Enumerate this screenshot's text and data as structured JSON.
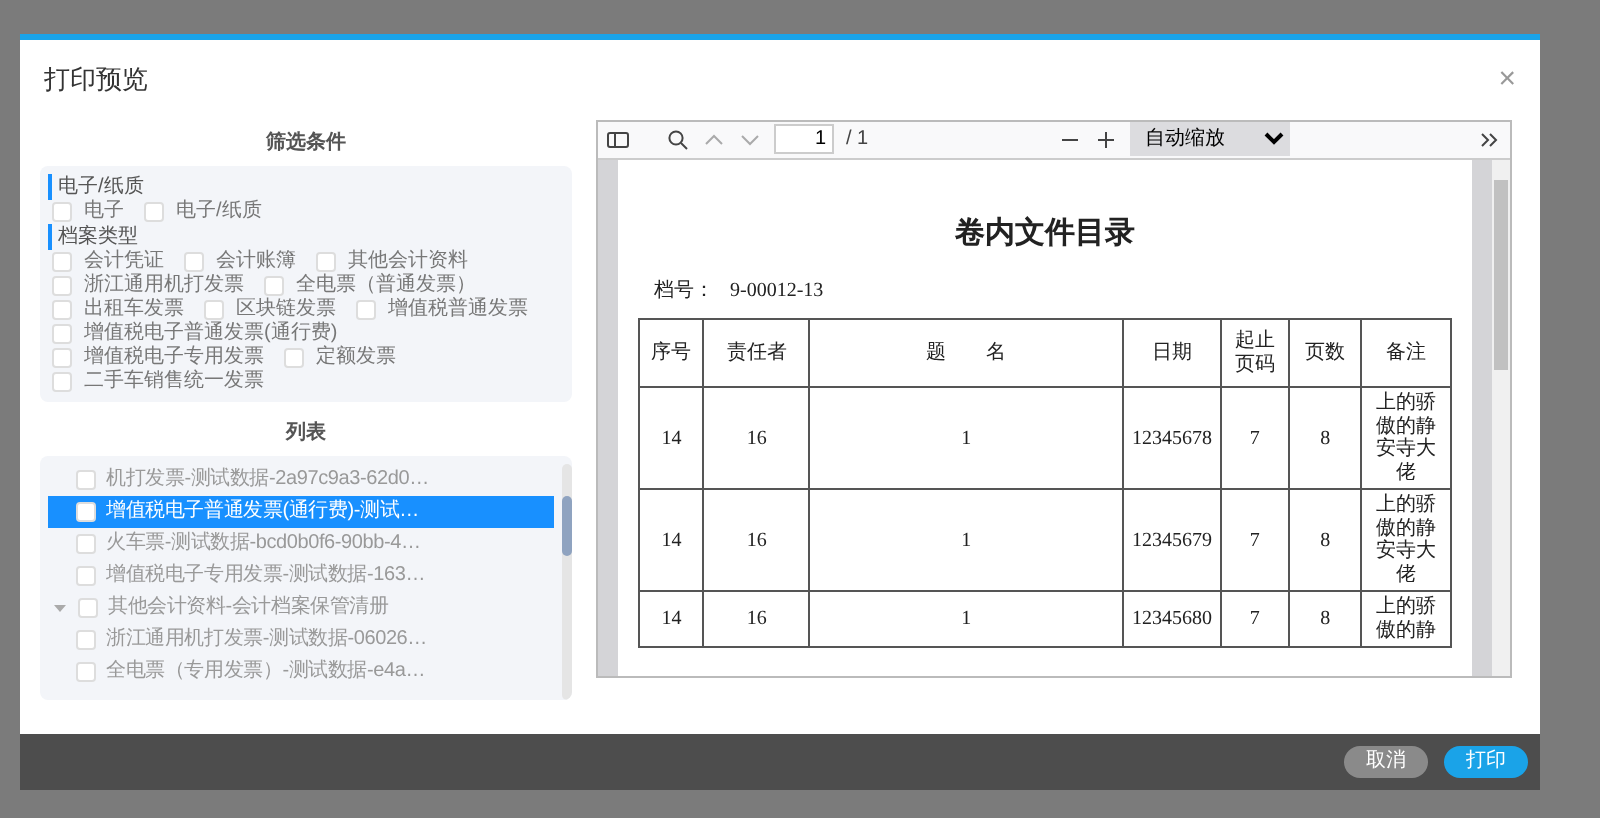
{
  "dialog": {
    "title": "打印预览",
    "close": "×"
  },
  "filter": {
    "title": "筛选条件",
    "groups": [
      {
        "label": "电子/纸质",
        "options": [
          {
            "label": "电子",
            "checked": false
          },
          {
            "label": "电子/纸质",
            "checked": false
          }
        ]
      },
      {
        "label": "档案类型",
        "options": [
          {
            "label": "会计凭证",
            "checked": false
          },
          {
            "label": "会计账簿",
            "checked": false
          },
          {
            "label": "其他会计资料",
            "checked": false
          },
          {
            "label": "浙江通用机打发票",
            "checked": false
          },
          {
            "label": "全电票（普通发票）",
            "checked": false
          },
          {
            "label": "出租车发票",
            "checked": false
          },
          {
            "label": "区块链发票",
            "checked": false
          },
          {
            "label": "增值税普通发票",
            "checked": false
          },
          {
            "label": "增值税电子普通发票(通行费)",
            "checked": false
          },
          {
            "label": "增值税电子专用发票",
            "checked": false
          },
          {
            "label": "定额发票",
            "checked": false
          },
          {
            "label": "二手车销售统一发票",
            "checked": false
          }
        ]
      }
    ]
  },
  "list": {
    "title": "列表",
    "items": [
      {
        "children": [
          {
            "label": "机打发票-测试数据-2a97c9a3-62d0…",
            "checked": false,
            "selected": false
          },
          {
            "label": "增值税电子普通发票(通行费)-测试…",
            "checked": false,
            "selected": true
          },
          {
            "label": "火车票-测试数据-bcd0b0f6-90bb-4…",
            "checked": false,
            "selected": false
          },
          {
            "label": "增值税电子专用发票-测试数据-163…",
            "checked": false,
            "selected": false
          }
        ]
      },
      {
        "label": "其他会计资料-会计档案保管清册",
        "checked": false,
        "selected": false,
        "expanded": true,
        "children": [
          {
            "label": "浙江通用机打发票-测试数据-06026…",
            "checked": false,
            "selected": false
          },
          {
            "label": "全电票（专用发票）-测试数据-e4a…",
            "checked": false,
            "selected": false
          }
        ]
      }
    ]
  },
  "viewer": {
    "page_number": "1",
    "page_count": "/ 1",
    "zoom": "自动缩放",
    "document": {
      "title": "卷内文件目录",
      "file_no_label": "档号：",
      "file_no": "9-00012-13",
      "columns": [
        "序号",
        "责任者",
        "题　　名",
        "日期",
        "起止页码",
        "页数",
        "备注"
      ],
      "rows": [
        [
          "14",
          "16",
          "1",
          "12345678",
          "7",
          "8",
          "上的骄傲的静安寺大佬"
        ],
        [
          "14",
          "16",
          "1",
          "12345679",
          "7",
          "8",
          "上的骄傲的静安寺大佬"
        ],
        [
          "14",
          "16",
          "1",
          "12345680",
          "7",
          "8",
          "上的骄傲的静"
        ]
      ]
    }
  },
  "buttons": [
    {
      "label": "取消",
      "kind": "secondary"
    },
    {
      "label": "打印",
      "kind": "primary"
    }
  ]
}
